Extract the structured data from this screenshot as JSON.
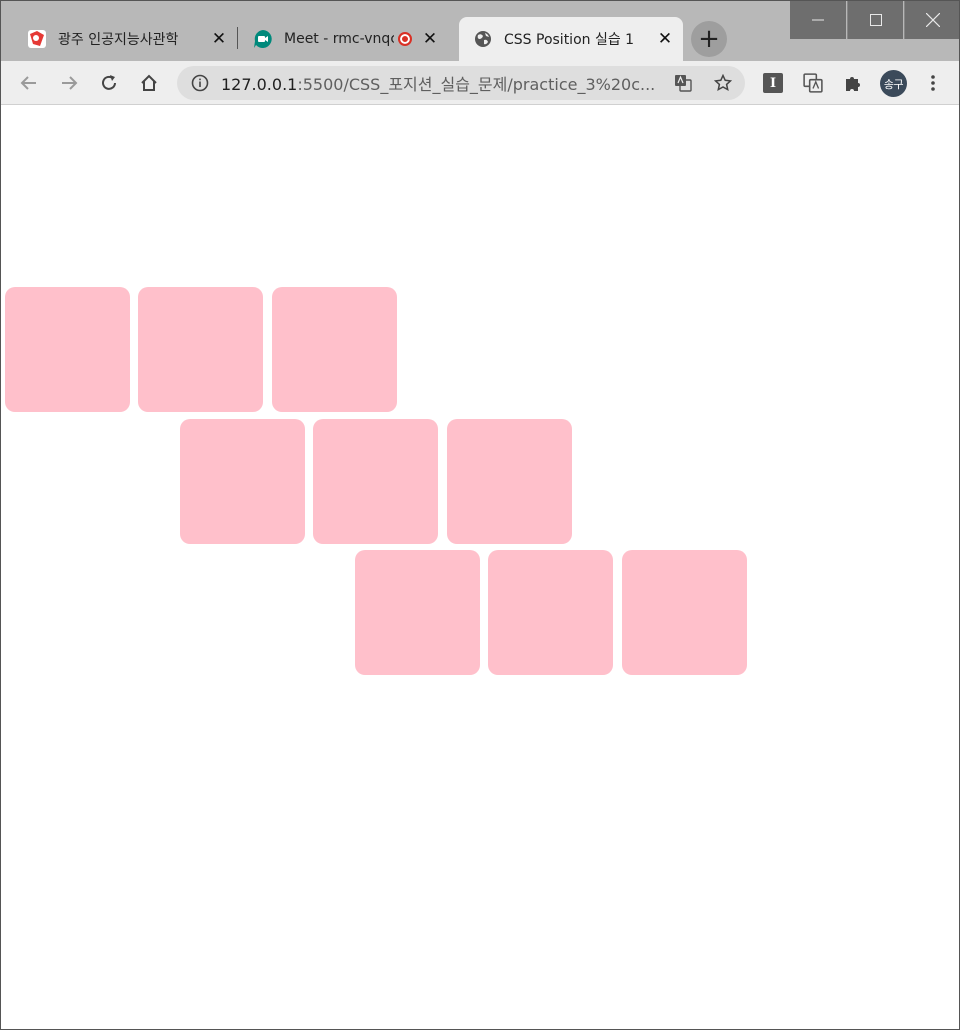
{
  "colors": {
    "box": "#ffc0cb",
    "tabstrip": "#b8b8b8",
    "active_tab": "#eeeeee",
    "record": "#d93025"
  },
  "tabs": [
    {
      "title": "광주 인공지능사관학",
      "icon": "red-favicon-icon",
      "close": "✕"
    },
    {
      "title": "Meet - rmc-vnqc",
      "icon": "google-meet-icon",
      "close": "✕"
    },
    {
      "title": "CSS Position 실습 1",
      "icon": "globe-icon",
      "close": "✕"
    }
  ],
  "new_tab": "+",
  "address_bar": {
    "host": "127.0.0.1",
    "rest": ":5500/CSS_포지션_실습_문제/practice_3%20c..."
  },
  "profile": {
    "initials": "송구"
  },
  "extensions": {
    "first": "I"
  },
  "boxes": {
    "rows": 3,
    "per_row": 3
  }
}
